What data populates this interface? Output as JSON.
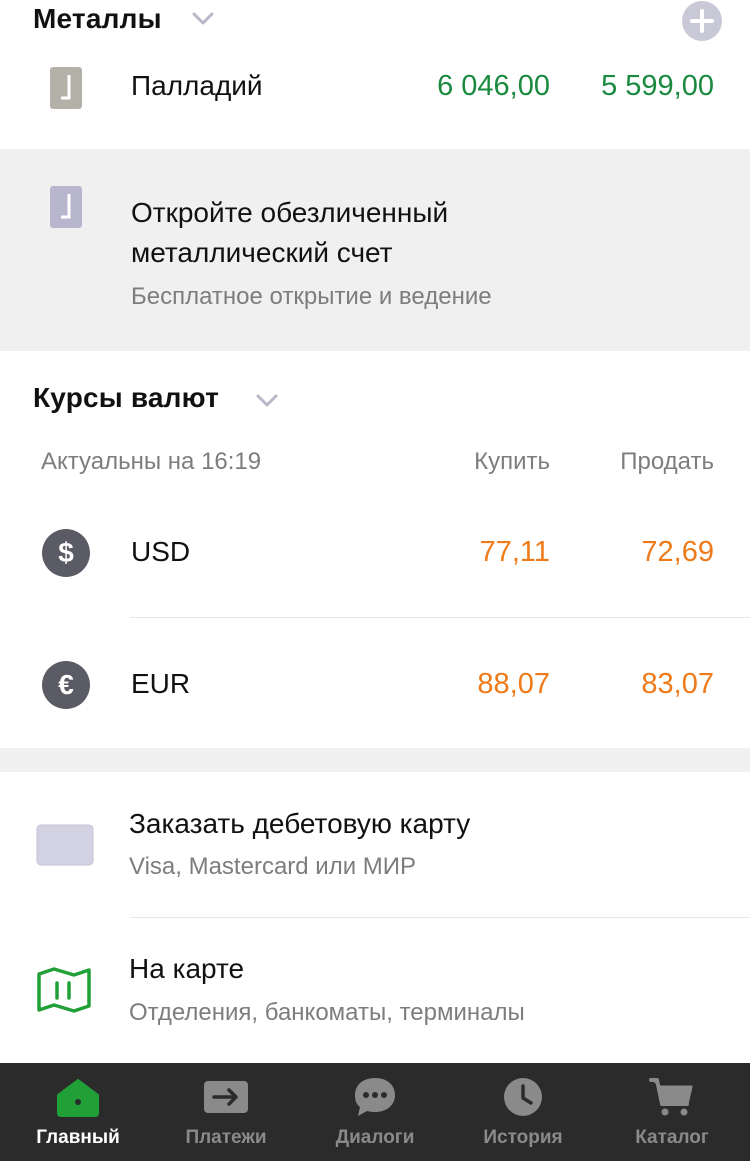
{
  "metals": {
    "title": "Металлы",
    "rows": [
      {
        "name": "Палладий",
        "buy": "6 046,00",
        "sell": "5 599,00"
      }
    ]
  },
  "promo": {
    "title": "Откройте обезличенный металлический счет",
    "subtitle": "Бесплатное открытие и ведение"
  },
  "fx": {
    "title": "Курсы валют",
    "updated": "Актуальны на 16:19",
    "buy_label": "Купить",
    "sell_label": "Продать",
    "rows": [
      {
        "code": "USD",
        "symbol": "$",
        "buy": "77,11",
        "sell": "72,69"
      },
      {
        "code": "EUR",
        "symbol": "€",
        "buy": "88,07",
        "sell": "83,07"
      }
    ]
  },
  "services": [
    {
      "title": "Заказать дебетовую карту",
      "subtitle": "Visa, Mastercard или МИР",
      "icon": "card-icon"
    },
    {
      "title": "На карте",
      "subtitle": "Отделения, банкоматы, терминалы",
      "icon": "map-icon"
    }
  ],
  "tabs": [
    {
      "label": "Главный",
      "icon": "home-icon",
      "active": true
    },
    {
      "label": "Платежи",
      "icon": "payments-icon",
      "active": false
    },
    {
      "label": "Диалоги",
      "icon": "chat-icon",
      "active": false
    },
    {
      "label": "История",
      "icon": "clock-icon",
      "active": false
    },
    {
      "label": "Каталог",
      "icon": "cart-icon",
      "active": false
    }
  ],
  "colors": {
    "green_value": "#1a8a3f",
    "orange_value": "#ef7a1a",
    "tabbar_bg": "#2b2b2b",
    "active_tab_icon": "#21a038"
  }
}
